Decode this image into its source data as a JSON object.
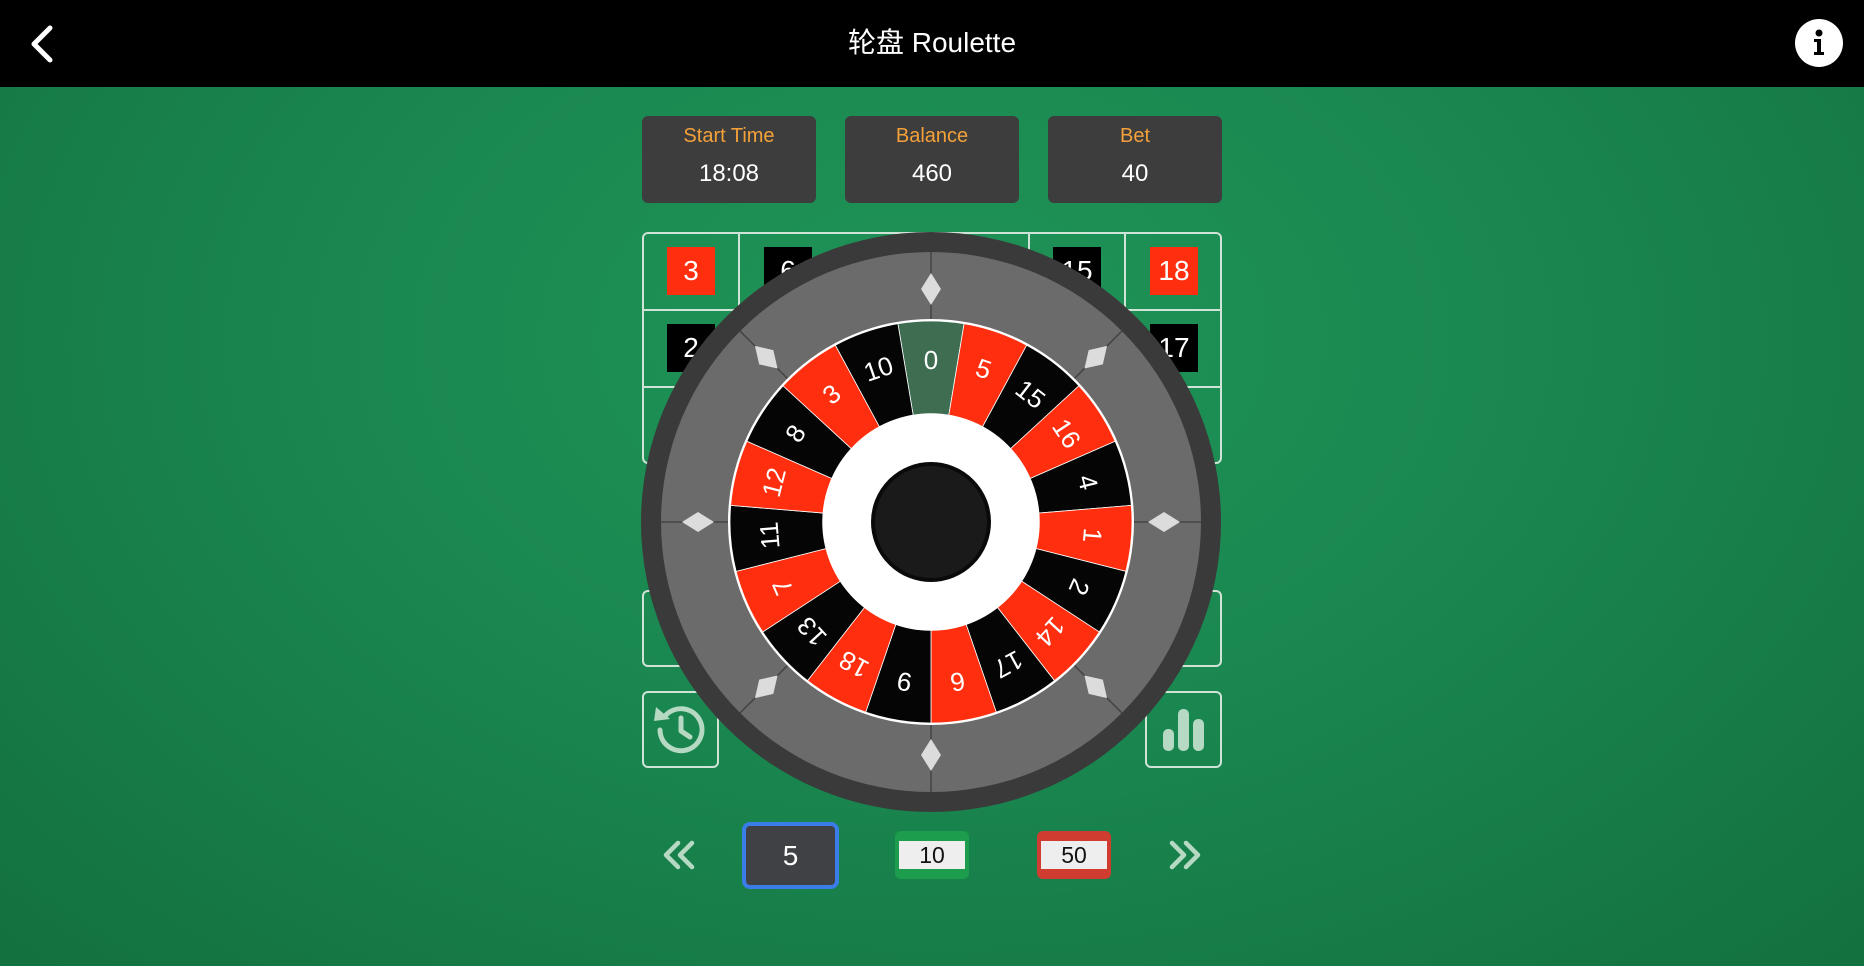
{
  "header": {
    "title": "轮盘 Roulette"
  },
  "stats": {
    "start_time": {
      "label": "Start Time",
      "value": "18:08"
    },
    "balance": {
      "label": "Balance",
      "value": "460"
    },
    "bet": {
      "label": "Bet",
      "value": "40"
    }
  },
  "board": {
    "row1": [
      {
        "label": "3",
        "color": "red"
      },
      {
        "label": "6",
        "color": "black"
      },
      {
        "label": "15",
        "color": "black"
      },
      {
        "label": "18",
        "color": "red"
      }
    ],
    "row2": [
      {
        "label": "2",
        "color": "black"
      },
      {
        "label": "17",
        "color": "black"
      }
    ]
  },
  "wheel": {
    "pockets": [
      {
        "n": "0",
        "color": "green"
      },
      {
        "n": "5",
        "color": "red"
      },
      {
        "n": "15",
        "color": "black"
      },
      {
        "n": "16",
        "color": "red"
      },
      {
        "n": "4",
        "color": "black"
      },
      {
        "n": "1",
        "color": "red"
      },
      {
        "n": "2",
        "color": "black"
      },
      {
        "n": "14",
        "color": "red"
      },
      {
        "n": "17",
        "color": "black"
      },
      {
        "n": "6",
        "color": "red"
      },
      {
        "n": "9",
        "color": "black"
      },
      {
        "n": "18",
        "color": "red"
      },
      {
        "n": "13",
        "color": "black"
      },
      {
        "n": "7",
        "color": "red"
      },
      {
        "n": "11",
        "color": "black"
      },
      {
        "n": "12",
        "color": "red"
      },
      {
        "n": "8",
        "color": "black"
      },
      {
        "n": "3",
        "color": "red"
      },
      {
        "n": "10",
        "color": "black"
      }
    ],
    "ball_pocket": "0",
    "colors": {
      "red": "#ff2e0f",
      "black": "#050505",
      "green": "#3e6d52",
      "rim": "#3a3a3a",
      "track": "#6b6b6b"
    }
  },
  "chips": {
    "items": [
      {
        "label": "5",
        "selected": true
      },
      {
        "label": "10",
        "color": "#1c9c4d"
      },
      {
        "label": "50",
        "color": "#d13c30"
      }
    ]
  },
  "icons": {
    "back": "chevron-left-icon",
    "info": "info-icon",
    "history": "history-icon",
    "stats": "bar-chart-icon",
    "prev": "double-chevron-left-icon",
    "next": "double-chevron-right-icon"
  }
}
